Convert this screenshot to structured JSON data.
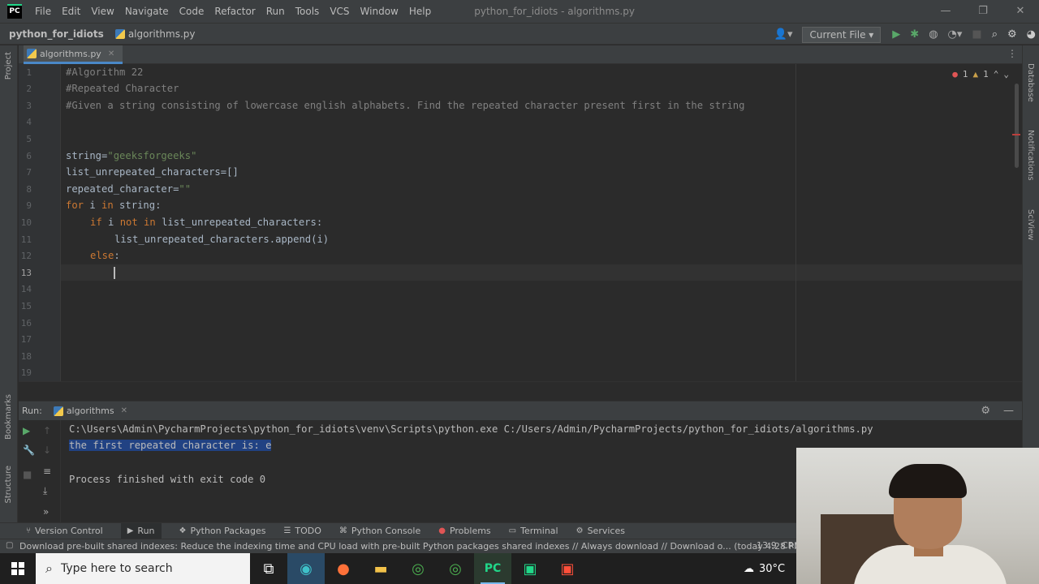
{
  "titlebar": {
    "menu": [
      "File",
      "Edit",
      "View",
      "Navigate",
      "Code",
      "Refactor",
      "Run",
      "Tools",
      "VCS",
      "Window",
      "Help"
    ],
    "window_title": "python_for_idiots - algorithms.py",
    "logo": "PC"
  },
  "navbar": {
    "project": "python_for_idiots",
    "file": "algorithms.py",
    "run_config": "Current File"
  },
  "left_strip": {
    "top_label": "Project",
    "bookmarks_label": "Bookmarks",
    "structure_label": "Structure"
  },
  "right_strip": {
    "database_label": "Database",
    "notifications_label": "Notifications",
    "sciview_label": "SciView"
  },
  "editor": {
    "tab": "algorithms.py",
    "inspection": {
      "errors": "1",
      "warnings": "1"
    },
    "line_numbers": [
      "1",
      "2",
      "3",
      "4",
      "5",
      "6",
      "7",
      "8",
      "9",
      "10",
      "11",
      "12",
      "13",
      "14",
      "15",
      "16",
      "17",
      "18",
      "19"
    ],
    "lines": {
      "l1": "#Algorithm 22",
      "l2": "#Repeated Character",
      "l3": "#Given a string consisting of lowercase english alphabets. Find the repeated character present first in the string",
      "l6_var": "string=",
      "l6_str": "\"geeksforgeeks\"",
      "l7": "list_unrepeated_characters=[]",
      "l8_var": "repeated_character=",
      "l8_str": "\"\"",
      "l9_kw1": "for",
      "l9_mid": " i ",
      "l9_kw2": "in",
      "l9_rest": " string:",
      "l10_kw1": "if",
      "l10_mid": " i ",
      "l10_kw2": "not in",
      "l10_rest": " list_unrepeated_characters:",
      "l11": "list_unrepeated_characters.append(i)",
      "l12_kw": "else",
      "l12_rest": ":"
    }
  },
  "run_panel": {
    "title": "Run:",
    "tab": "algorithms",
    "console": {
      "command": "C:\\Users\\Admin\\PycharmProjects\\python_for_idiots\\venv\\Scripts\\python.exe C:/Users/Admin/PycharmProjects/python_for_idiots/algorithms.py",
      "output": "the first repeated character is: e",
      "exit": "Process finished with exit code 0"
    }
  },
  "toolwindows": [
    "Version Control",
    "Run",
    "Python Packages",
    "TODO",
    "Python Console",
    "Problems",
    "Terminal",
    "Services"
  ],
  "statusbar": {
    "message": "Download pre-built shared indexes: Reduce the indexing time and CPU load with pre-built Python packages shared indexes // Always download // Download o... (today 4:28 PM)",
    "position": "13:9",
    "encoding": "CRL"
  },
  "taskbar": {
    "search_placeholder": "Type here to search",
    "temperature": "30°C"
  },
  "colors": {
    "accent_blue": "#4a88c7",
    "keyword": "#cc7832",
    "string": "#6a8759",
    "comment": "#808080",
    "selection": "#214283"
  }
}
